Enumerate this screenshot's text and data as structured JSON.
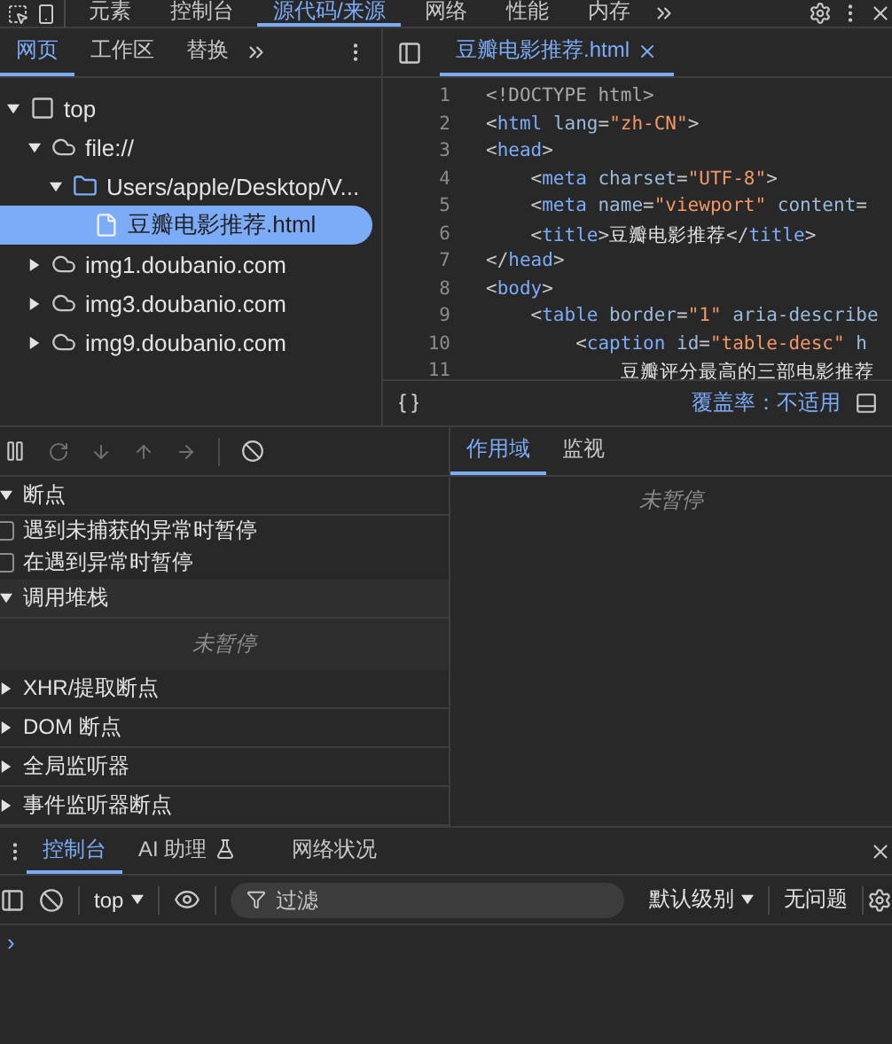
{
  "main_tabs": [
    {
      "label": "元素",
      "selected": false
    },
    {
      "label": "控制台",
      "selected": false
    },
    {
      "label": "源代码/来源",
      "selected": true
    },
    {
      "label": "网络",
      "selected": false
    },
    {
      "label": "性能",
      "selected": false
    },
    {
      "label": "内存",
      "selected": false
    }
  ],
  "navigator": {
    "tabs": [
      {
        "label": "网页",
        "selected": true
      },
      {
        "label": "工作区",
        "selected": false
      },
      {
        "label": "替换",
        "selected": false
      }
    ],
    "tree": [
      {
        "label": "top",
        "kind": "frame",
        "expanded": true,
        "selected": false,
        "children": [
          {
            "label": "file://",
            "kind": "cloud",
            "expanded": true,
            "selected": false,
            "children": [
              {
                "label": "Users/apple/Desktop/V...",
                "kind": "folder",
                "expanded": true,
                "selected": false,
                "children": [
                  {
                    "label": "豆瓣电影推荐.html",
                    "kind": "file",
                    "selected": true
                  }
                ]
              }
            ]
          },
          {
            "label": "img1.doubanio.com",
            "kind": "cloud",
            "expanded": false,
            "selected": false
          },
          {
            "label": "img3.doubanio.com",
            "kind": "cloud",
            "expanded": false,
            "selected": false
          },
          {
            "label": "img9.doubanio.com",
            "kind": "cloud",
            "expanded": false,
            "selected": false
          }
        ]
      }
    ]
  },
  "editor": {
    "tab": {
      "label": "豆瓣电影推荐.html",
      "selected": true
    },
    "lines": [
      {
        "number": "1",
        "tokens": [
          {
            "kind": "doctype",
            "text": "<!DOCTYPE html>"
          }
        ]
      },
      {
        "number": "2",
        "tokens": [
          {
            "kind": "punct",
            "text": "<"
          },
          {
            "kind": "tag",
            "text": "html"
          },
          {
            "kind": "attr",
            "text": " lang"
          },
          {
            "kind": "punct",
            "text": "="
          },
          {
            "kind": "value",
            "text": "\"zh-CN\""
          },
          {
            "kind": "punct",
            "text": ">"
          }
        ]
      },
      {
        "number": "3",
        "tokens": [
          {
            "kind": "punct",
            "text": "<"
          },
          {
            "kind": "tag",
            "text": "head"
          },
          {
            "kind": "punct",
            "text": ">"
          }
        ]
      },
      {
        "number": "4",
        "tokens": [
          {
            "kind": "punct",
            "text": "    <"
          },
          {
            "kind": "tag",
            "text": "meta"
          },
          {
            "kind": "attr",
            "text": " charset"
          },
          {
            "kind": "punct",
            "text": "="
          },
          {
            "kind": "value",
            "text": "\"UTF-8\""
          },
          {
            "kind": "punct",
            "text": ">"
          }
        ]
      },
      {
        "number": "5",
        "tokens": [
          {
            "kind": "punct",
            "text": "    <"
          },
          {
            "kind": "tag",
            "text": "meta"
          },
          {
            "kind": "attr",
            "text": " name"
          },
          {
            "kind": "punct",
            "text": "="
          },
          {
            "kind": "value",
            "text": "\"viewport\""
          },
          {
            "kind": "attr",
            "text": " content"
          },
          {
            "kind": "punct",
            "text": "="
          }
        ]
      },
      {
        "number": "6",
        "tokens": [
          {
            "kind": "punct",
            "text": "    <"
          },
          {
            "kind": "tag",
            "text": "title"
          },
          {
            "kind": "punct",
            "text": ">"
          },
          {
            "kind": "text",
            "text": "豆瓣电影推荐"
          },
          {
            "kind": "punct",
            "text": "</"
          },
          {
            "kind": "tag",
            "text": "title"
          },
          {
            "kind": "punct",
            "text": ">"
          }
        ]
      },
      {
        "number": "7",
        "tokens": [
          {
            "kind": "punct",
            "text": "</"
          },
          {
            "kind": "tag",
            "text": "head"
          },
          {
            "kind": "punct",
            "text": ">"
          }
        ]
      },
      {
        "number": "8",
        "tokens": [
          {
            "kind": "punct",
            "text": "<"
          },
          {
            "kind": "tag",
            "text": "body"
          },
          {
            "kind": "punct",
            "text": ">"
          }
        ]
      },
      {
        "number": "9",
        "tokens": [
          {
            "kind": "punct",
            "text": "    <"
          },
          {
            "kind": "tag",
            "text": "table"
          },
          {
            "kind": "attr",
            "text": " border"
          },
          {
            "kind": "punct",
            "text": "="
          },
          {
            "kind": "value",
            "text": "\"1\""
          },
          {
            "kind": "attr",
            "text": " aria-describe"
          }
        ]
      },
      {
        "number": "10",
        "tokens": [
          {
            "kind": "punct",
            "text": "        <"
          },
          {
            "kind": "tag",
            "text": "caption"
          },
          {
            "kind": "attr",
            "text": " id"
          },
          {
            "kind": "punct",
            "text": "="
          },
          {
            "kind": "value",
            "text": "\"table-desc\""
          },
          {
            "kind": "attr",
            "text": " h"
          }
        ]
      },
      {
        "number": "11",
        "tokens": [
          {
            "kind": "text",
            "text": "            豆瓣评分最高的三部电影推荐"
          }
        ]
      }
    ],
    "footer": {
      "coverage": "覆盖率：不适用"
    }
  },
  "debugger": {
    "sections": [
      {
        "kind": "header",
        "label": "断点",
        "expanded": true
      },
      {
        "kind": "checkbox",
        "label": "遇到未捕获的异常时暂停",
        "checked": false
      },
      {
        "kind": "checkbox",
        "label": "在遇到异常时暂停",
        "checked": false
      },
      {
        "kind": "header",
        "label": "调用堆栈",
        "expanded": true
      },
      {
        "kind": "note",
        "label": "未暂停"
      },
      {
        "kind": "header",
        "label": "XHR/提取断点",
        "expanded": false
      },
      {
        "kind": "header",
        "label": "DOM 断点",
        "expanded": false
      },
      {
        "kind": "header",
        "label": "全局监听器",
        "expanded": false
      },
      {
        "kind": "header",
        "label": "事件监听器断点",
        "expanded": false
      }
    ],
    "side_tabs": [
      {
        "label": "作用域",
        "selected": true
      },
      {
        "label": "监视",
        "selected": false
      }
    ],
    "side_note": "未暂停"
  },
  "drawer": {
    "tabs": [
      {
        "label": "控制台",
        "selected": true,
        "kind": "plain"
      },
      {
        "label": "AI 助理",
        "selected": false,
        "kind": "experiment"
      },
      {
        "label": "网络状况",
        "selected": false,
        "kind": "plain"
      }
    ],
    "context": "top",
    "filter": {
      "placeholder": "过滤"
    },
    "level": "默认级别",
    "issues": "无问题",
    "prompt": "›"
  }
}
